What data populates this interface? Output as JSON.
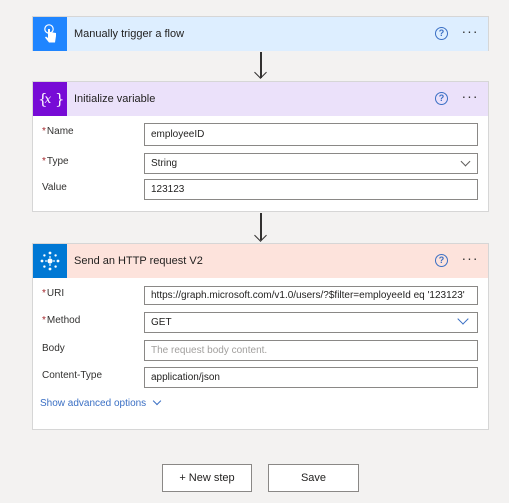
{
  "trigger": {
    "title": "Manually trigger a flow",
    "icon": "hand-touch-icon",
    "header_color": "#ddeeff",
    "icon_color": "#1f85ff"
  },
  "init_variable": {
    "title": "Initialize variable",
    "icon": "variable-icon",
    "header_color": "#ebe1fa",
    "icon_color": "#770bd6",
    "name_label": "Name",
    "name_value": "employeeID",
    "type_label": "Type",
    "type_value": "String",
    "value_label": "Value",
    "value_value": "123123"
  },
  "http": {
    "title": "Send an HTTP request V2",
    "icon": "http-connector-icon",
    "header_color": "#fde3dc",
    "icon_color": "#0078d4",
    "uri_label": "URI",
    "uri_value": "https://graph.microsoft.com/v1.0/users/?$filter=employeeId eq '123123'",
    "method_label": "Method",
    "method_value": "GET",
    "body_label": "Body",
    "body_placeholder": "The request body content.",
    "content_type_label": "Content-Type",
    "content_type_value": "application/json",
    "advanced_label": "Show advanced options"
  },
  "footer": {
    "new_step_label": "+ New step",
    "save_label": "Save"
  },
  "help_glyph": "?",
  "more_glyph": "···",
  "required_mark": "*"
}
